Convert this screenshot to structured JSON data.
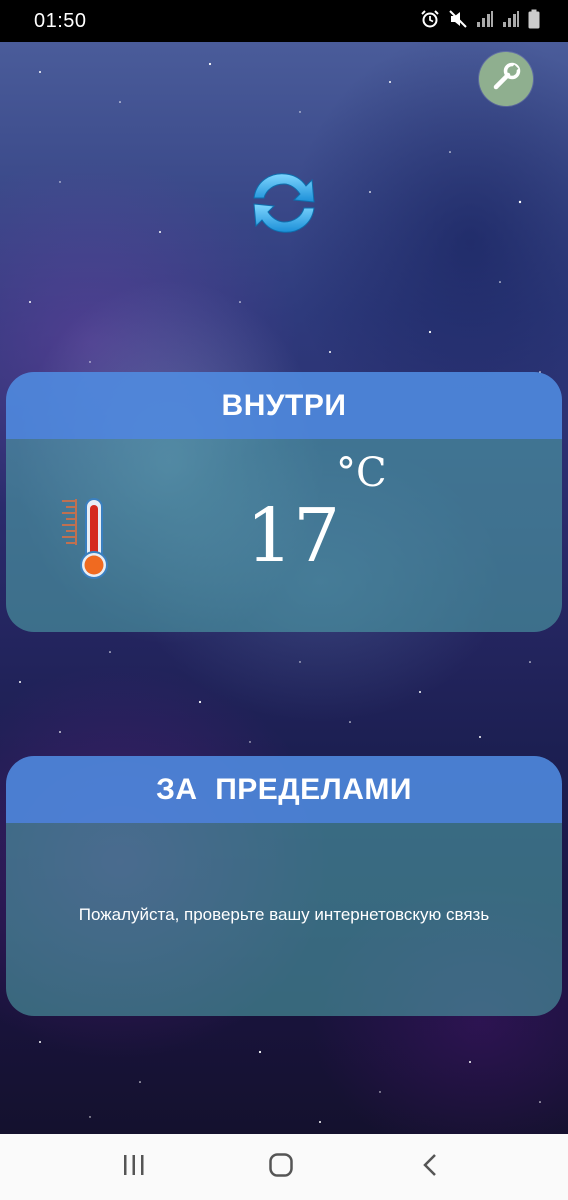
{
  "status_bar": {
    "time": "01:50",
    "icons": [
      "alarm-icon",
      "mute-icon",
      "signal-icon",
      "signal-icon",
      "battery-icon"
    ]
  },
  "toolbar": {
    "settings_icon": "wrench-icon",
    "refresh_icon": "refresh-icon"
  },
  "inside": {
    "title": "ВНУТРИ",
    "temperature": "17",
    "unit": "°C",
    "icon": "thermometer-icon"
  },
  "outside": {
    "title": "ЗА  ПРЕДЕЛАМИ",
    "message": "Пожалуйста, проверьте вашу интернетовскую связь"
  },
  "nav_bar": {
    "icons": [
      "recents-icon",
      "home-icon",
      "back-icon"
    ]
  },
  "colors": {
    "card_header": "#508ce1",
    "card_body": "#50a5aa",
    "wrench_button": "#8faf8f",
    "refresh_arrow": "#2ba8e8"
  }
}
